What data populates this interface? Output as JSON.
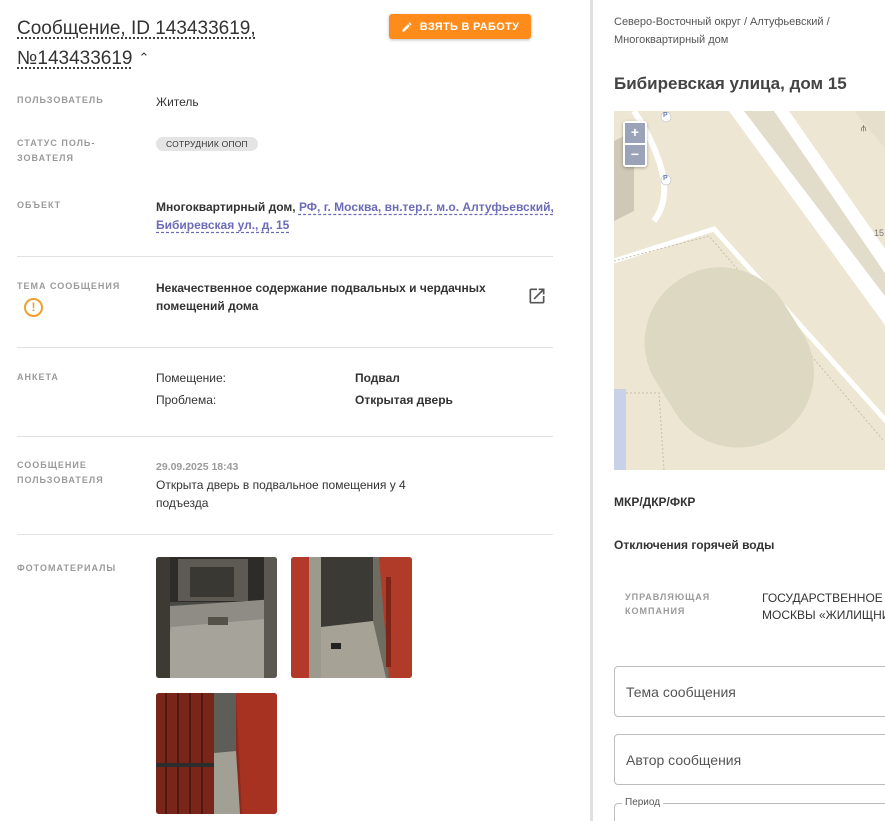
{
  "message": {
    "title": "Сообщение, ID 143433619, №143433619",
    "take_button": "ВЗЯТЬ В РАБОТУ"
  },
  "fields": {
    "user_label": "ПОЛЬЗОВАТЕЛЬ",
    "user_value": "Житель",
    "status_label": "СТАТУС ПОЛЬ-ЗОВАТЕЛЯ",
    "status_badge": "СОТРУДНИК ОПОП",
    "object_label": "ОБЪЕКТ",
    "object_type": "Многоквартирный дом,",
    "object_link": "РФ, г. Москва, вн.тер.г. м.о. Алтуфьевский, Бибиревская ул., д. 15",
    "topic_label": "ТЕМА СООБЩЕНИЯ",
    "topic_value": "Некачественное содержание подвальных и чердачных помещений дома",
    "survey_label": "АНКЕТА",
    "survey": [
      {
        "key": "Помещение:",
        "value": "Подвал"
      },
      {
        "key": "Проблема:",
        "value": "Открытая дверь"
      }
    ],
    "user_msg_label": "СООБЩЕНИЕ ПОЛЬЗОВАТЕЛЯ",
    "user_msg_date": "29.09.2025 18:43",
    "user_msg_text": "Открыта дверь в подвальное помещения у 4 подъезда",
    "photos_label": "ФОТОМАТЕРИАЛЫ"
  },
  "right": {
    "breadcrumb": "Северо-Восточный округ / Алтуфьевский / Многоквартирный дом",
    "address": "Бибиревская улица, дом 15",
    "map_zoom_in": "+",
    "map_zoom_out": "−",
    "map_parking": "P",
    "map_house_number": "15",
    "mkr": "МКР/ДКР/ФКР",
    "hot_water": "Отключения горячей воды",
    "mgmt_label": "УПРАВЛЯЮЩАЯ КОМПАНИЯ",
    "mgmt_value_1": "ГОСУДАРСТВЕННОЕ Б",
    "mgmt_value_2": "МОСКВЫ «ЖИЛИЩНИ",
    "topic_placeholder": "Тема сообщения",
    "author_placeholder": "Автор сообщения",
    "period_label": "Период"
  },
  "colors": {
    "accent": "#ff8c1a",
    "link": "#6c6bb8",
    "warning": "#f0a02a"
  }
}
